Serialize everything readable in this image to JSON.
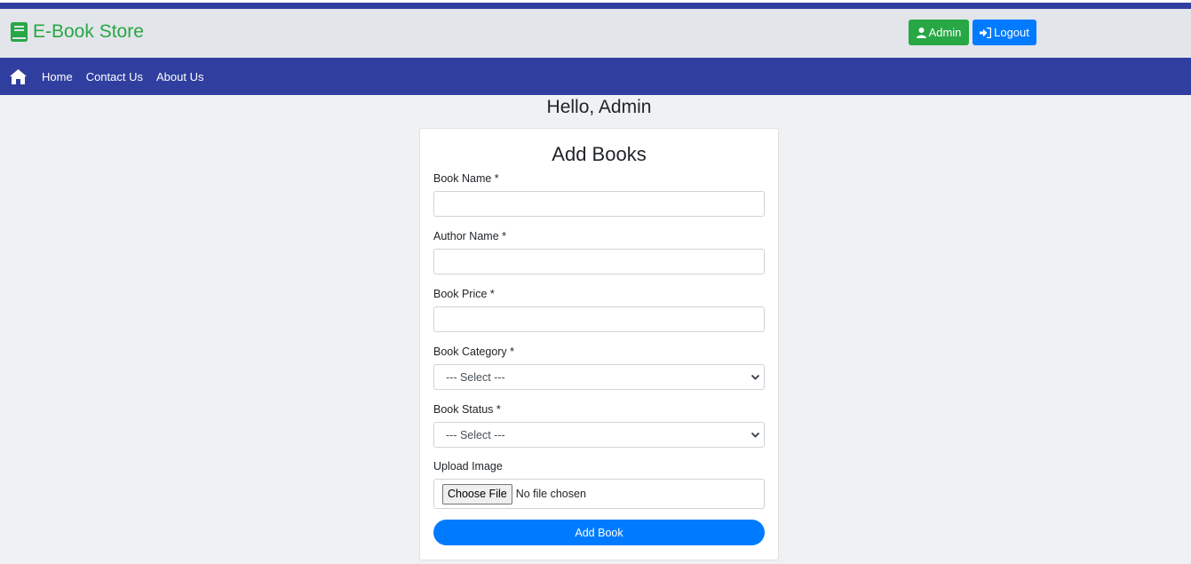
{
  "header": {
    "brand": "E-Book Store",
    "admin_label": "Admin",
    "logout_label": "Logout"
  },
  "nav": {
    "items": [
      "Home",
      "Contact Us",
      "About Us"
    ]
  },
  "greeting": "Hello, Admin",
  "form": {
    "title": "Add Books",
    "book_name_label": "Book Name *",
    "book_name_value": "",
    "author_name_label": "Author Name *",
    "author_name_value": "",
    "book_price_label": "Book Price *",
    "book_price_value": "",
    "category_label": "Book Category *",
    "category_selected": "--- Select ---",
    "status_label": "Book Status *",
    "status_selected": "--- Select ---",
    "upload_label": "Upload Image",
    "file_button": "Choose File",
    "file_status": "No file chosen",
    "submit_label": "Add Book"
  },
  "colors": {
    "nav_blue": "#303f9f",
    "brand_green": "#28a745",
    "primary_blue": "#007bff"
  },
  "icons": [
    "book-icon",
    "user-icon",
    "sign-in-icon",
    "home-icon",
    "chevron-down-icon"
  ]
}
